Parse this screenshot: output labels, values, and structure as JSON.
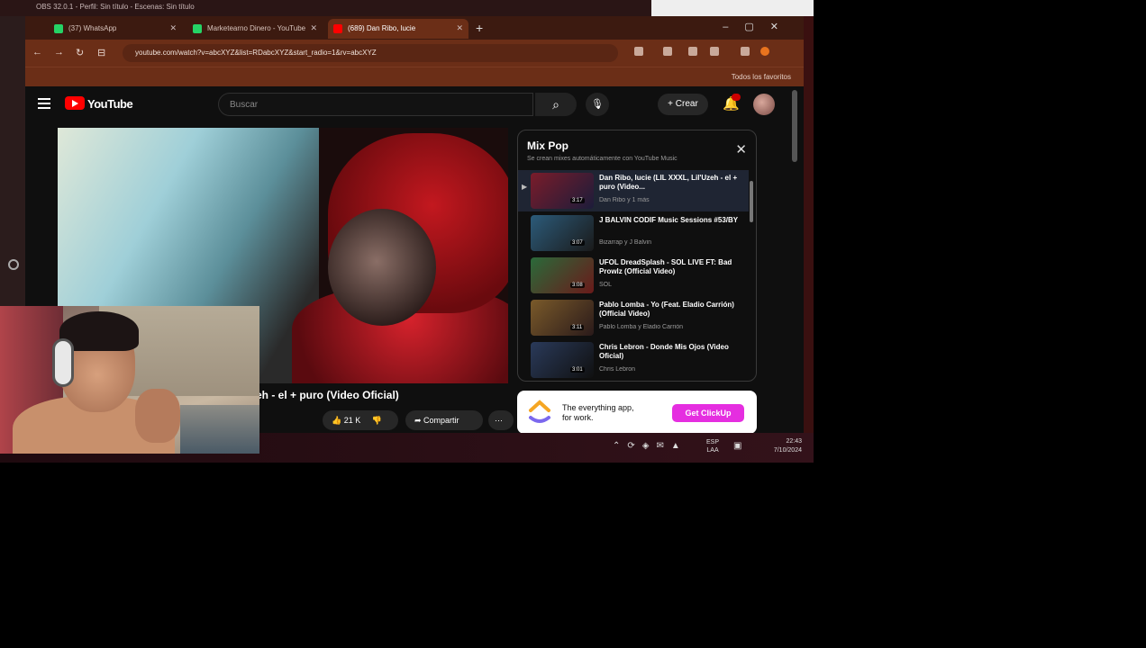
{
  "window": {
    "title": "OBS 32.0.1 - Perfil: Sin título - Escenas: Sin título",
    "taskbar_time": "22:43",
    "taskbar_date": "7/10/2024",
    "taskbar_lang_top": "ESP",
    "taskbar_lang_bottom": "LAA"
  },
  "browser": {
    "tabs": [
      {
        "label": "(37) WhatsApp",
        "favicon_color": "#25d366",
        "active": false
      },
      {
        "label": "Marketearno Dinero - YouTube",
        "favicon_color": "#25d366",
        "active": false
      },
      {
        "label": "(689) Dan Ribo, lucie",
        "favicon_color": "#ff0000",
        "active": true
      }
    ],
    "new_tab": "+",
    "url": "youtube.com/watch?v=abcXYZ&list=RDabcXYZ&start_radio=1&rv=abcXYZ",
    "bookmarks_label": "Todos los favoritos"
  },
  "youtube": {
    "logo_text": "YouTube",
    "search_placeholder": "Buscar",
    "create_label": "Crear",
    "current_video_title": "eh - el + puro (Video Oficial)",
    "like_count": "21 K",
    "share_label": "Compartir",
    "more_label": "⋯",
    "mix": {
      "title": "Mix Pop",
      "subtitle": "Se crean mixes automáticamente con YouTube Music",
      "close": "✕",
      "items": [
        {
          "title": "Dan Ribo, lucie (LIL XXXL, Lil'Uzeh - el + puro (Video...",
          "channel": "Dan Ribo y 1 más",
          "duration": "3:17",
          "thumb": "#7a1c2a",
          "playing": true
        },
        {
          "title": "J BALVIN CODIF Music Sessions #53/BY",
          "channel": "Bizarrap y J Balvin",
          "duration": "3:07",
          "thumb": "#2c5b7a",
          "playing": false
        },
        {
          "title": "UFOL DreadSplash - SOL LIVE FT: Bad Prowlz (Official Video)",
          "channel": "SOL",
          "duration": "3:08",
          "thumb": "#2a6a3a",
          "playing": false
        },
        {
          "title": "Pablo Lomba - Yo (Feat. Eladio Carrión) (Official Video)",
          "channel": "Pablo Lomba y Eladio Carrión",
          "duration": "3:11",
          "thumb": "#7a5a2a",
          "playing": false
        },
        {
          "title": "Chris Lebron - Donde Mis Ojos (Video Oficial)",
          "channel": "Chris Lebron",
          "duration": "3:01",
          "thumb": "#2a3a5a",
          "playing": false
        }
      ]
    },
    "ad": {
      "text": "The everything app, for work.",
      "button": "Get ClickUp"
    }
  },
  "colors": {
    "youtube_red": "#ff0000",
    "browser_frame": "#6b2e17",
    "ad_button": "#e52ee0"
  }
}
